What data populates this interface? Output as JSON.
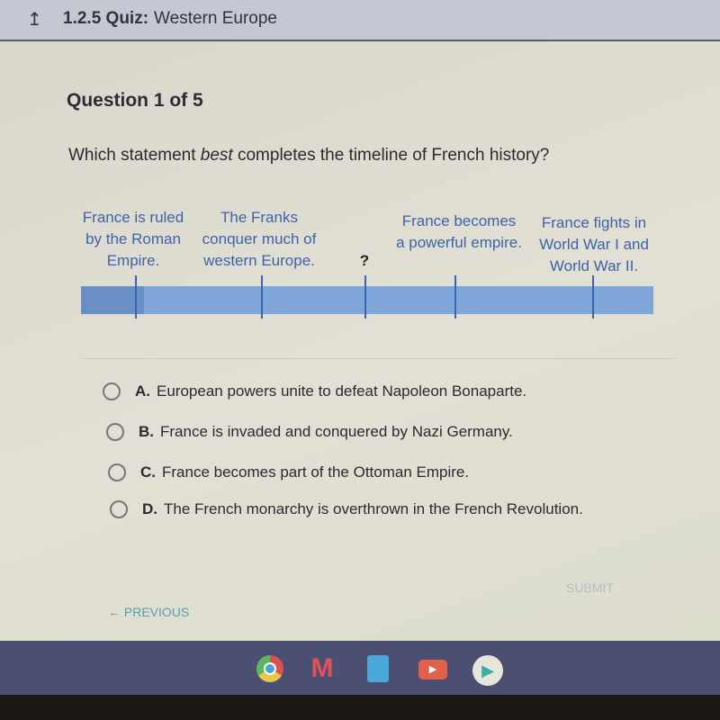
{
  "header": {
    "back_icon": "up-arrow-icon",
    "code": "1.2.5 Quiz:",
    "title": "Western Europe"
  },
  "question": {
    "number": "Question 1 of 5",
    "prompt_pre": "Which statement ",
    "prompt_em": "best",
    "prompt_post": " completes the timeline of French history?"
  },
  "timeline": {
    "events": [
      {
        "label": "France is ruled by the Roman Empire."
      },
      {
        "label": "The Franks conquer much of western Europe."
      },
      {
        "label": "?"
      },
      {
        "label": "France becomes a powerful empire."
      },
      {
        "label": "France fights in World War I and World War II."
      }
    ],
    "bar_color": "#7fa6d6"
  },
  "options": [
    {
      "letter": "A.",
      "text": "European powers unite to defeat Napoleon Bonaparte."
    },
    {
      "letter": "B.",
      "text": "France is invaded and conquered by Nazi Germany."
    },
    {
      "letter": "C.",
      "text": "France becomes part of the Ottoman Empire."
    },
    {
      "letter": "D.",
      "text": "The French monarchy is overthrown in the French Revolution."
    }
  ],
  "footer": {
    "submit": "SUBMIT",
    "previous": "PREVIOUS",
    "previous_icon": "left-arrow-icon"
  },
  "taskbar": {
    "apps": [
      "chrome-icon",
      "gmail-icon",
      "docs-icon",
      "youtube-icon",
      "play-store-icon"
    ]
  }
}
